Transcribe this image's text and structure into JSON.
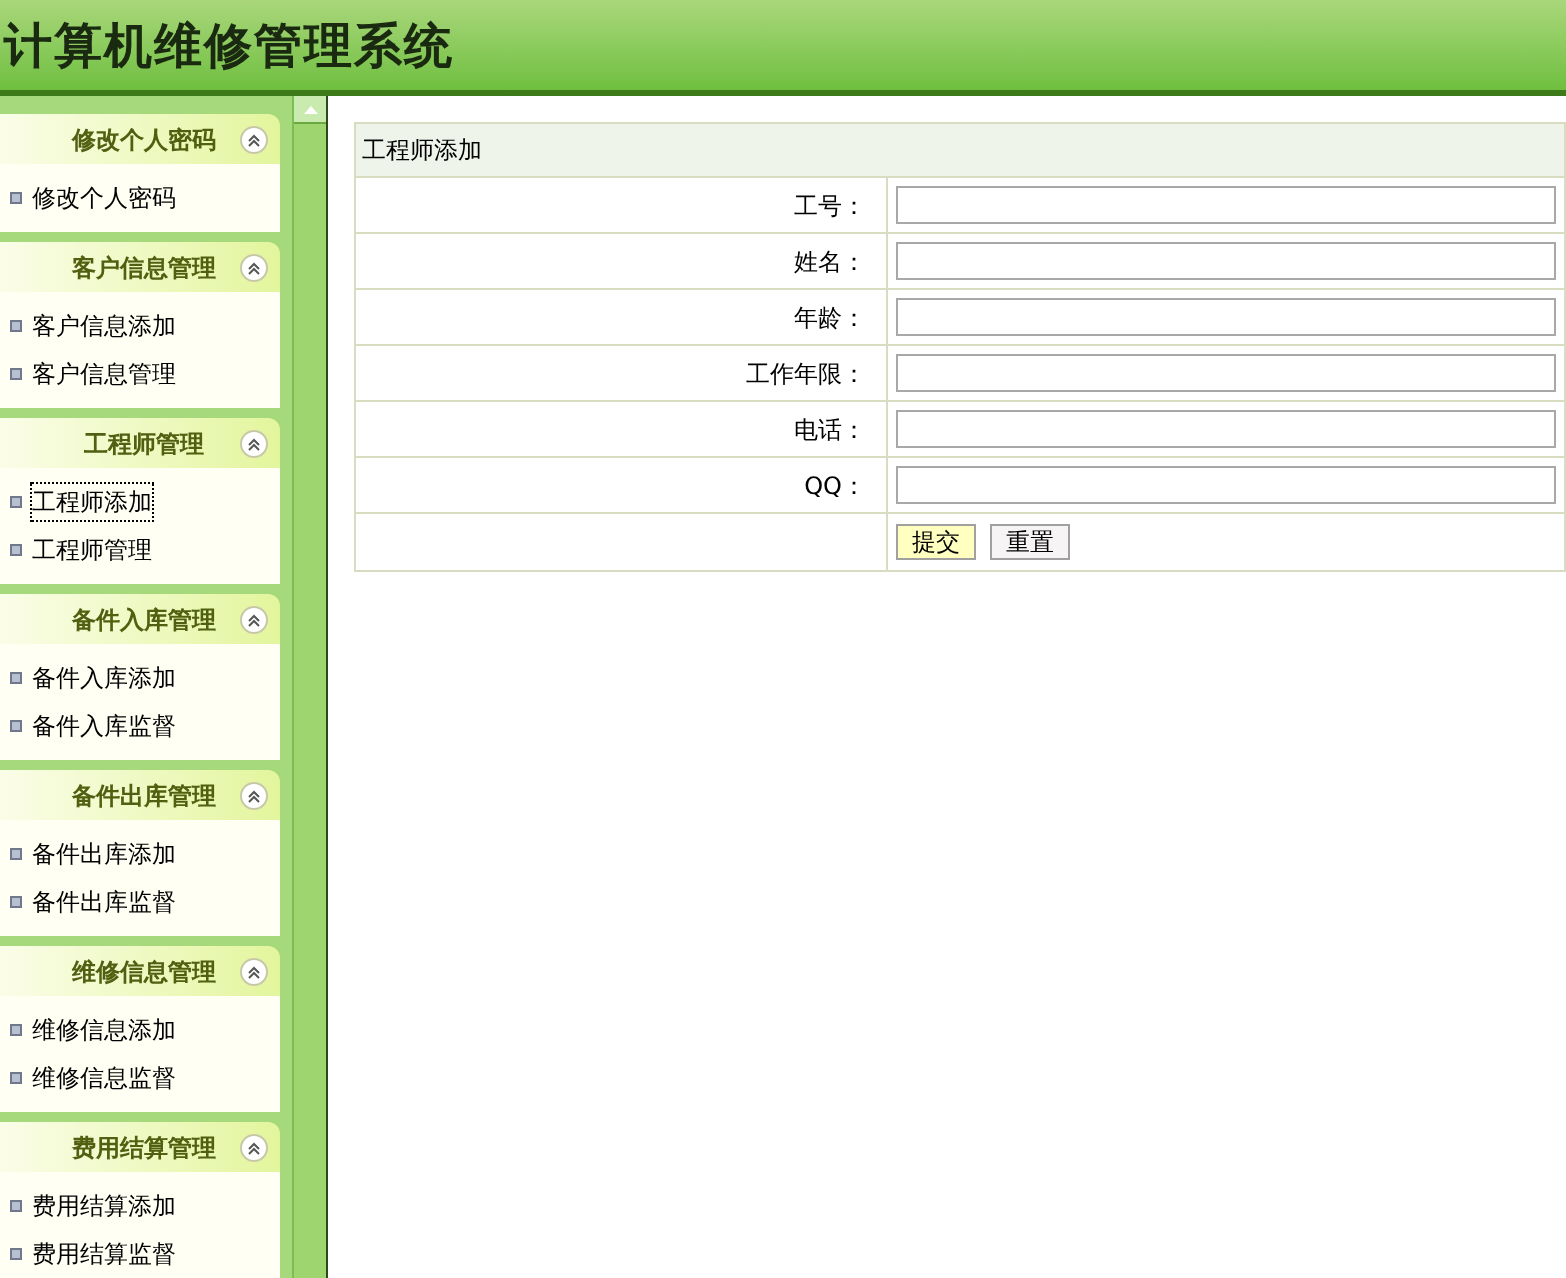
{
  "header": {
    "title": "计算机维修管理系统"
  },
  "sidebar": {
    "sections": [
      {
        "title": "修改个人密码",
        "expanded": true,
        "items": [
          {
            "label": "修改个人密码",
            "selected": false
          }
        ]
      },
      {
        "title": "客户信息管理",
        "expanded": true,
        "items": [
          {
            "label": "客户信息添加",
            "selected": false
          },
          {
            "label": "客户信息管理",
            "selected": false
          }
        ]
      },
      {
        "title": "工程师管理",
        "expanded": true,
        "items": [
          {
            "label": "工程师添加",
            "selected": true
          },
          {
            "label": "工程师管理",
            "selected": false
          }
        ]
      },
      {
        "title": "备件入库管理",
        "expanded": true,
        "items": [
          {
            "label": "备件入库添加",
            "selected": false
          },
          {
            "label": "备件入库监督",
            "selected": false
          }
        ]
      },
      {
        "title": "备件出库管理",
        "expanded": true,
        "items": [
          {
            "label": "备件出库添加",
            "selected": false
          },
          {
            "label": "备件出库监督",
            "selected": false
          }
        ]
      },
      {
        "title": "维修信息管理",
        "expanded": true,
        "items": [
          {
            "label": "维修信息添加",
            "selected": false
          },
          {
            "label": "维修信息监督",
            "selected": false
          }
        ]
      },
      {
        "title": "费用结算管理",
        "expanded": true,
        "items": [
          {
            "label": "费用结算添加",
            "selected": false
          },
          {
            "label": "费用结算监督",
            "selected": false
          }
        ]
      }
    ]
  },
  "form": {
    "title": "工程师添加",
    "fields": [
      {
        "label": "工号："
      },
      {
        "label": "姓名："
      },
      {
        "label": "年龄："
      },
      {
        "label": "工作年限："
      },
      {
        "label": "电话："
      },
      {
        "label": "QQ："
      }
    ],
    "buttons": [
      {
        "label": "提交",
        "kind": "primary"
      },
      {
        "label": "重置",
        "kind": "secondary"
      }
    ]
  }
}
